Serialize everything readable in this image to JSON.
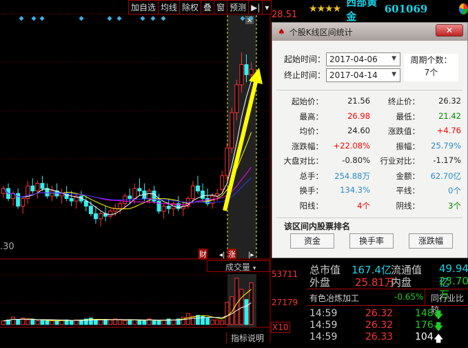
{
  "toolbar": {
    "items": [
      "加自选",
      "均线",
      "除权",
      "叠",
      "窗",
      "预测"
    ],
    "pin_icon": "pin-right-icon",
    "menu_icon": "chevron-down-icon"
  },
  "stock": {
    "rating": "★★★★",
    "name": "西部黄金",
    "code": "601069"
  },
  "chart": {
    "price_top": "28.51",
    "price_bottom": ".30",
    "vol_top": "53711",
    "vol_mid": "27179",
    "vol_mult": "X10",
    "indicator": "成交量",
    "indicator_help": "指标说明",
    "tag_cai": "财",
    "tag_zhang": "涨",
    "candles": [
      [
        21.4,
        21.7,
        21.2,
        21.6
      ],
      [
        21.6,
        21.8,
        21.1,
        21.2
      ],
      [
        21.2,
        21.5,
        20.9,
        21.4
      ],
      [
        21.4,
        21.6,
        20.8,
        20.9
      ],
      [
        20.9,
        21.3,
        20.6,
        21.2
      ],
      [
        21.2,
        21.9,
        21.0,
        21.7
      ],
      [
        21.7,
        22.0,
        21.4,
        21.5
      ],
      [
        21.5,
        21.9,
        21.2,
        21.8
      ],
      [
        21.8,
        22.1,
        21.5,
        21.6
      ],
      [
        21.6,
        21.8,
        21.2,
        21.3
      ],
      [
        21.3,
        21.7,
        21.1,
        21.5
      ],
      [
        21.5,
        21.8,
        21.2,
        21.3
      ],
      [
        21.3,
        21.6,
        21.0,
        21.4
      ],
      [
        21.4,
        21.7,
        21.1,
        21.2
      ],
      [
        21.2,
        21.5,
        20.9,
        21.1
      ],
      [
        21.1,
        21.4,
        20.8,
        21.3
      ],
      [
        21.3,
        21.5,
        21.0,
        21.1
      ],
      [
        21.1,
        21.3,
        20.7,
        20.9
      ],
      [
        20.9,
        21.1,
        20.5,
        20.6
      ],
      [
        20.6,
        20.9,
        20.2,
        20.4
      ],
      [
        20.4,
        20.7,
        20.1,
        20.6
      ],
      [
        20.6,
        20.9,
        20.3,
        20.5
      ],
      [
        20.5,
        20.8,
        20.4,
        20.7
      ],
      [
        20.7,
        21.0,
        20.5,
        20.8
      ],
      [
        20.8,
        21.1,
        20.6,
        21.0
      ],
      [
        21.0,
        21.4,
        20.8,
        21.3
      ],
      [
        21.3,
        21.6,
        21.0,
        21.2
      ],
      [
        21.2,
        21.8,
        21.0,
        21.6
      ],
      [
        21.6,
        22.0,
        21.3,
        21.5
      ],
      [
        21.5,
        21.8,
        21.1,
        21.2
      ],
      [
        21.2,
        21.6,
        21.0,
        21.5
      ],
      [
        21.5,
        21.7,
        21.0,
        21.1
      ],
      [
        21.1,
        21.4,
        20.6,
        20.7
      ],
      [
        20.7,
        21.0,
        20.4,
        20.9
      ],
      [
        20.9,
        21.2,
        20.6,
        20.8
      ],
      [
        20.8,
        21.1,
        20.5,
        21.0
      ],
      [
        21.0,
        21.3,
        20.7,
        20.8
      ],
      [
        20.8,
        21.1,
        20.5,
        20.9
      ],
      [
        20.9,
        21.3,
        20.8,
        21.2
      ],
      [
        21.2,
        21.9,
        21.0,
        21.7
      ],
      [
        21.7,
        22.1,
        21.4,
        21.5
      ],
      [
        21.5,
        21.8,
        21.1,
        21.2
      ],
      [
        21.2,
        21.6,
        20.9,
        21.0
      ],
      [
        21.0,
        21.4,
        20.8,
        21.3
      ],
      [
        21.3,
        21.6,
        21.1,
        21.4
      ],
      [
        21.56,
        22.3,
        21.42,
        22.1
      ],
      [
        22.1,
        23.4,
        21.9,
        23.2
      ],
      [
        23.2,
        24.8,
        23.0,
        24.6
      ],
      [
        24.6,
        25.9,
        24.3,
        25.7
      ],
      [
        25.7,
        26.98,
        25.4,
        26.5
      ],
      [
        26.5,
        26.9,
        25.8,
        26.1
      ],
      [
        26.1,
        26.6,
        25.9,
        26.32
      ]
    ],
    "volumes": [
      5,
      5,
      4,
      4,
      4,
      5,
      8,
      5,
      7,
      5,
      5,
      4,
      5,
      4,
      4,
      4,
      5,
      5,
      4,
      5,
      5,
      6,
      7,
      5,
      5,
      5,
      5,
      6,
      5,
      4,
      5,
      5,
      5,
      4,
      6,
      4,
      4,
      5,
      6,
      5,
      6,
      8,
      12,
      9,
      10,
      9,
      7,
      5,
      5,
      4,
      24,
      30,
      50,
      38,
      27,
      45
    ]
  },
  "dialog": {
    "title": "个股K线区间统计",
    "close": "✕",
    "start_label": "起始时间：",
    "start_value": "2017-04-06",
    "end_label": "终止时间：",
    "end_value": "2017-04-14",
    "period_label": "周期个数：",
    "period_value": "7个",
    "stats": [
      {
        "l": "起始价：",
        "v": "21.56",
        "c": "",
        "l2": "终止价：",
        "v2": "26.32",
        "c2": ""
      },
      {
        "l": "最高：",
        "v": "26.98",
        "c": "red",
        "l2": "最低：",
        "v2": "21.42",
        "c2": "green"
      },
      {
        "l": "均价：",
        "v": "24.60",
        "c": "",
        "l2": "涨跌值：",
        "v2": "+4.76",
        "c2": "red"
      },
      {
        "l": "涨跌幅：",
        "v": "+22.08%",
        "c": "red",
        "l2": "振幅：",
        "v2": "25.79%",
        "c2": "blue"
      },
      {
        "l": "大盘对比：",
        "v": "-0.80%",
        "c": "",
        "l2": "行业对比：",
        "v2": "-1.17%",
        "c2": ""
      },
      {
        "l": "总手：",
        "v": "254.88万",
        "c": "blue",
        "l2": "金额：",
        "v2": "62.70亿",
        "c2": "blue"
      },
      {
        "l": "换手：",
        "v": "134.3%",
        "c": "blue",
        "l2": "平线：",
        "v2": "0个",
        "c2": "blue"
      },
      {
        "l": "阳线：",
        "v": "4个",
        "c": "red",
        "l2": "阴线：",
        "v2": "3个",
        "c2": "green"
      }
    ],
    "rank_title": "该区间内股票排名",
    "buttons": [
      "资金",
      "换手率",
      "涨跌幅"
    ]
  },
  "panel": {
    "mcap_l": "总市值",
    "mcap_v": "167.4亿",
    "float_l": "流通值",
    "float_v": "49.94亿",
    "outer_l": "外盘",
    "outer_v": "25.81万",
    "inner_l": "内盘",
    "inner_v": "23.70万",
    "industry": "有色冶炼加工",
    "industry_chg": "-0.65%",
    "compare": "同行业比较",
    "ticks": [
      {
        "t": "14:59",
        "p": "26.32",
        "v": "148",
        "d": "down"
      },
      {
        "t": "14:59",
        "p": "26.32",
        "v": "176",
        "d": "down"
      },
      {
        "t": "14:59",
        "p": "26.33",
        "v": "104",
        "d": "up"
      }
    ]
  }
}
